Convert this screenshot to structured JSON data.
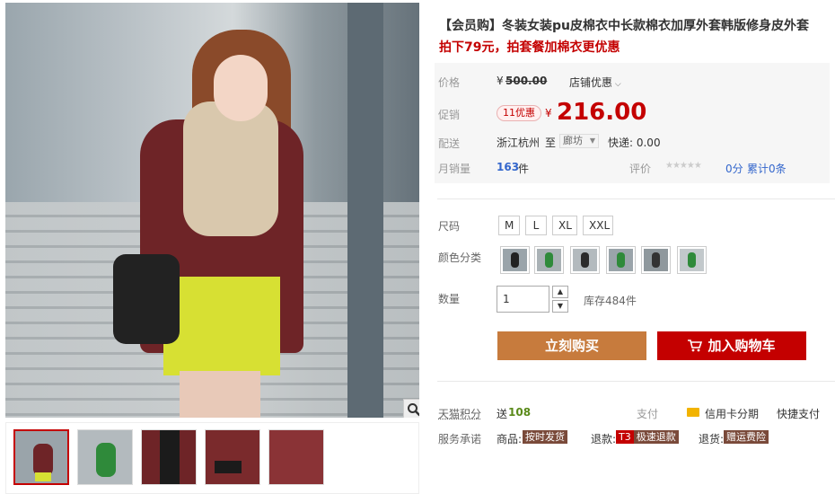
{
  "product": {
    "title": "【会员购】冬装女装pu皮棉衣中长款棉衣加厚外套韩版修身皮外套",
    "subtitle": "拍下79元，拍套餐加棉衣更优惠"
  },
  "pricing": {
    "price_label": "价格",
    "currency": "¥",
    "original_price": "500.00",
    "shop_discount": "店铺优惠",
    "promo_label": "促销",
    "promo_tag": "11优惠",
    "promo_price": "216.00"
  },
  "shipping": {
    "label": "配送",
    "origin": "浙江杭州",
    "to": "至",
    "destination": "廊坊",
    "fee": "快递: 0.00"
  },
  "sales": {
    "label": "月销量",
    "count": "163",
    "unit": "件",
    "rating_label": "评价",
    "stars": "★★★★★",
    "score": "0分",
    "total_reviews": "累计0条"
  },
  "size": {
    "label": "尺码",
    "options": [
      "M",
      "L",
      "XL",
      "XXL"
    ]
  },
  "color": {
    "label": "颜色分类"
  },
  "quantity": {
    "label": "数量",
    "value": "1",
    "stock": "库存484件"
  },
  "actions": {
    "buy_now": "立刻购买",
    "add_cart": "加入购物车",
    "add_cart_icon": "cart-icon"
  },
  "footer": {
    "points_label": "天猫积分",
    "points_prefix": "送",
    "points_value": "108",
    "pay_label": "支付",
    "credit_card": "信用卡分期",
    "quick_pay": "快捷支付",
    "service_label": "服务承诺",
    "goods_label": "商品:",
    "goods_badge": "按时发货",
    "return_label": "退款:",
    "return_badge_t3": "T3",
    "return_badge": "极速退款",
    "refund_label": "退货:",
    "refund_badge": "赠运费险"
  },
  "colors": {
    "accent": "#c40000",
    "buy_now": "#c77b3d",
    "points": "#5a8a1a",
    "link": "#3366cc"
  }
}
